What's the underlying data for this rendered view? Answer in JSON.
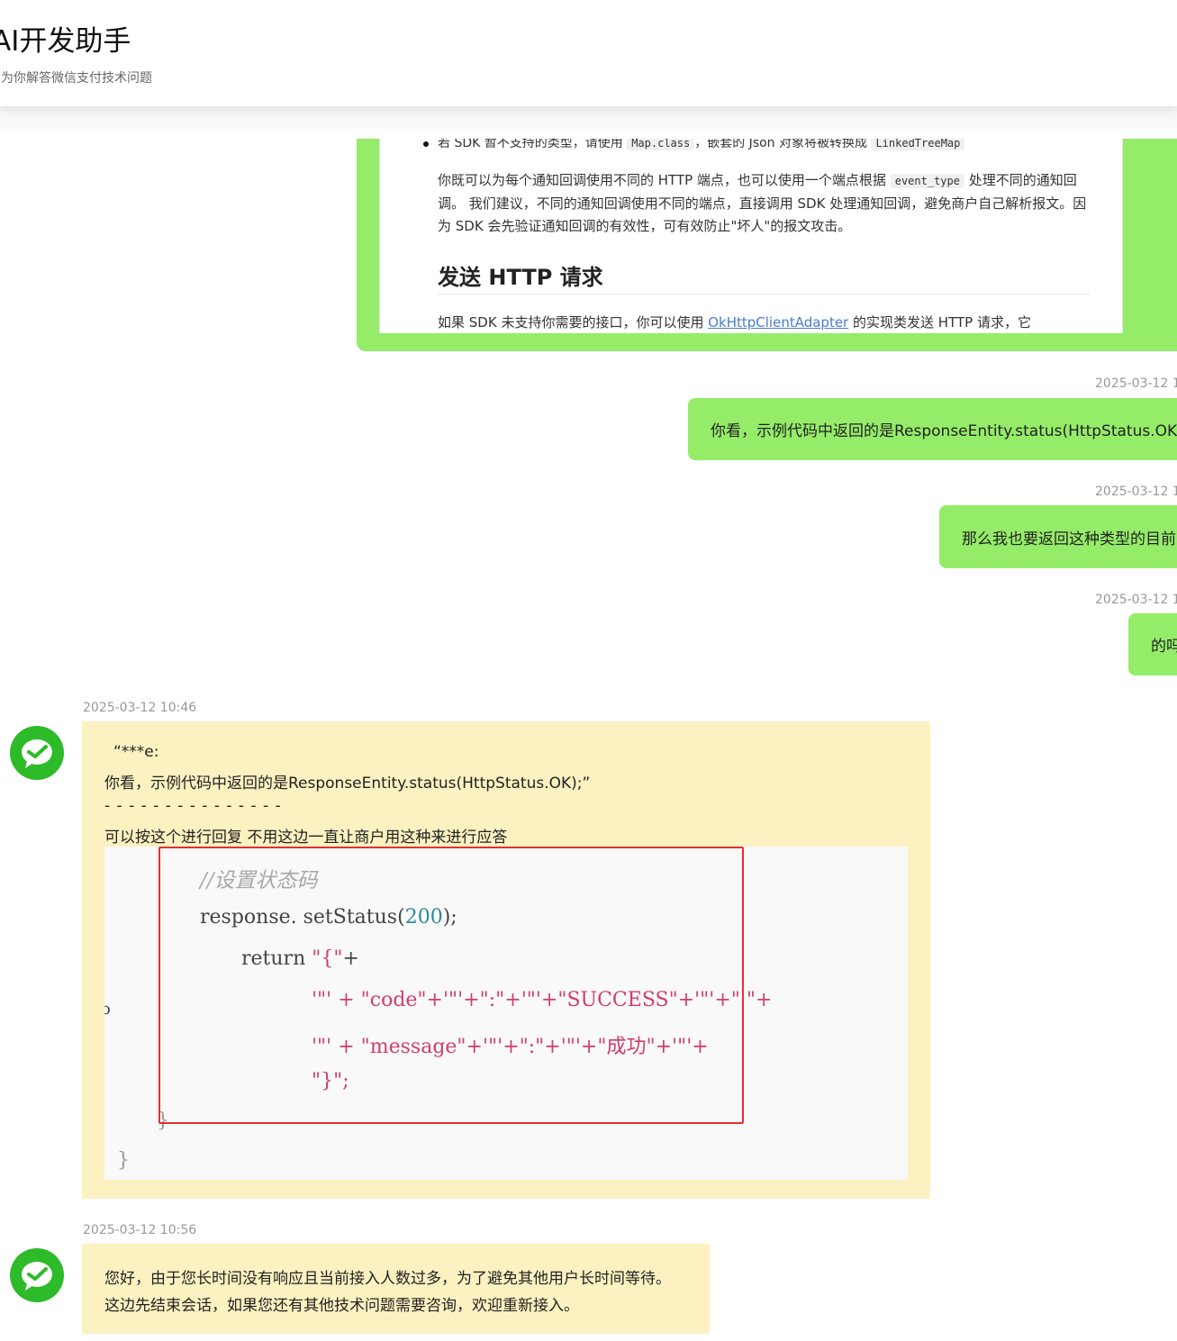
{
  "header": {
    "title": "AI开发助手",
    "subtitle": "为你解答微信支付技术问题"
  },
  "doc_screenshot": {
    "bullet_text_a": "若 SDK 暂不支持的类型，请使用",
    "bullet_code_a": "Map.class",
    "bullet_text_b": "，嵌套的 Json 对象将被转换成",
    "bullet_code_b": "LinkedTreeMap",
    "para_a": "你既可以为每个通知回调使用不同的 HTTP 端点，也可以使用一个端点根据",
    "para_code": "event_type",
    "para_b": "处理不同的通知回调。 我们建议，不同的通知回调使用不同的端点，直接调用 SDK 处理通知回调，避免商户自己解析报文。因为 SDK 会先验证通知回调的有效性，可有效防止\"坏人\"的报文攻击。",
    "heading": "发送 HTTP 请求",
    "para2_a": "如果 SDK 未支持你需要的接口，你可以使用",
    "para2_link": "OkHttpClientAdapter",
    "para2_b": "的实现类发送 HTTP 请求，它"
  },
  "outgoing": [
    {
      "time": "2025-03-12 1",
      "text": "你看，示例代码中返回的是ResponseEntity.status(HttpStatus.OK);"
    },
    {
      "time": "2025-03-12 1",
      "text": "那么我也要返回这种类型的目前"
    },
    {
      "time": "2025-03-12 1",
      "text": "的吗"
    }
  ],
  "incoming": [
    {
      "time": "2025-03-12 10:46",
      "quote_head": "“***e:",
      "quote_body": "你看，示例代码中返回的是ResponseEntity.status(HttpStatus.OK);”",
      "separator": "- - - - - - - - - - - - - - -",
      "reply": "可以按这个进行回复 不用这边一直让商户用这种来进行应答",
      "code": {
        "comment": "//设置状态码",
        "line1_a": "response. setStatus",
        "line1_paren_open": "(",
        "line1_num": "200",
        "line1_tail": ");",
        "line2_kw": "return",
        "line2_str": "\"{\"",
        "line2_plus": "+",
        "line3": "'\"' + \"code\"+'\"'+\":\"+'\"'+\"SUCCESS\"+'\"'+\"  \"+",
        "line4": "'\"' + \"message\"+'\"'+\":\"+'\"'+\"成功\"+'\"'+",
        "line5": "\"}\";",
        "close1": "}",
        "close2": "}",
        "side_mark": "o"
      }
    },
    {
      "time": "2025-03-12 10:56",
      "line1": "您好，由于您长时间没有响应且当前接入人数过多，为了避免其他用户长时间等待。",
      "line2": "这边先结束会话，如果您还有其他技术问题需要咨询，欢迎重新接入。"
    }
  ]
}
